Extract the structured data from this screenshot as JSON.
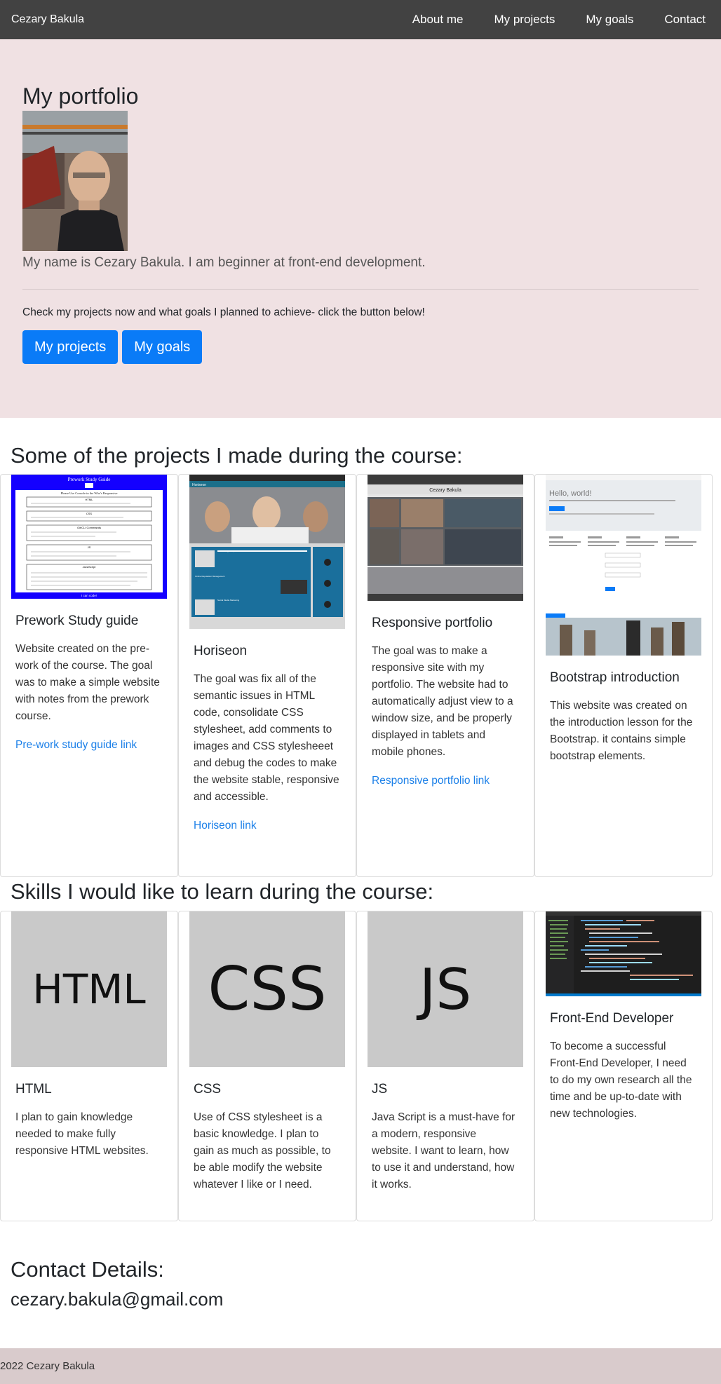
{
  "nav": {
    "brand": "Cezary Bakula",
    "links": [
      "About me",
      "My projects",
      "My goals",
      "Contact"
    ]
  },
  "hero": {
    "title": "My portfolio",
    "lead": "My name is Cezary Bakula. I am beginner at front-end development.",
    "text": "Check my projects now and what goals I planned to achieve- click the button below!",
    "buttons": [
      "My projects",
      "My goals"
    ]
  },
  "projects": {
    "heading": "Some of the projects I made during the course:",
    "cards": [
      {
        "title": "Prework Study guide",
        "text": "Website created on the pre-work of the course. The goal was to make a simple website with notes from the prework course.",
        "link": "Pre-work study guide link"
      },
      {
        "title": "Horiseon",
        "text": "The goal was fix all of the semantic issues in HTML code, consolidate CSS stylesheet, add comments to images and CSS stylesheeet and debug the codes to make the website stable, responsive and accessible.",
        "link": "Horiseon link"
      },
      {
        "title": "Responsive portfolio",
        "text": "The goal was to make a responsive site with my portfolio. The website had to automatically adjust view to a window size, and be properly displayed in tablets and mobile phones.",
        "link": "Responsive portfolio link"
      },
      {
        "title": "Bootstrap introduction",
        "text": "This website was created on the introduction lesson for the Bootstrap. it contains simple bootstrap elements.",
        "link": ""
      }
    ],
    "thumb_texts": {
      "prework_title": "Prework Study Guide",
      "prework_sub": "Please Use Console in the Who's Responsive",
      "prework_sections": [
        "HTML",
        "CSS",
        "Git/CLI Commands",
        "JS",
        "JavaScript"
      ],
      "prework_footer": "I can code!",
      "horiseon_brand": "Horiseon",
      "horiseon_panels": [
        "Search Engine Optimization",
        "Online Reputation Management",
        "Social Media Marketing"
      ],
      "portfolio_brand": "Cezary Bakula",
      "bootstrap_hello": "Hello, world!"
    }
  },
  "skills": {
    "heading": "Skills I would like to learn during the course:",
    "cards": [
      {
        "image_label": "HTML",
        "title": "HTML",
        "text": "I plan to gain knowledge needed to make fully responsive HTML websites."
      },
      {
        "image_label": "CSS",
        "title": "CSS",
        "text": "Use of CSS stylesheet is a basic knowledge. I plan to gain as much as possible, to be able modify the website whatever I like or I need."
      },
      {
        "image_label": "JS",
        "title": "JS",
        "text": "Java Script is a must-have for a modern, responsive website. I want to learn, how to use it and understand, how it works."
      },
      {
        "image_label": "",
        "title": "Front-End Developer",
        "text": "To become a successful Front-End Developer, I need to do my own research all the time and be up-to-date with new technologies."
      }
    ]
  },
  "contact": {
    "heading": "Contact Details:",
    "email": "cezary.bakula@gmail.com"
  },
  "footer": {
    "text": "2022 Cezary Bakula"
  },
  "colors": {
    "navbar": "#424242",
    "hero_bg": "#f0e1e3",
    "button": "#0a7bf7",
    "link": "#1a7fe8",
    "footer_bg": "#d9cbcc"
  }
}
